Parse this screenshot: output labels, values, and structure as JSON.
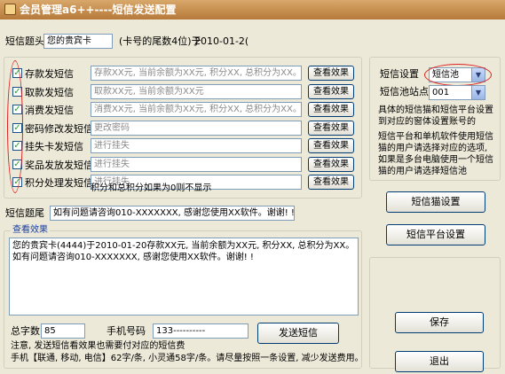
{
  "window": {
    "title": "会员管理a6++----短信发送配置"
  },
  "header": {
    "title_label": "短信题头",
    "title_value": "您的贵宾卡",
    "suffix_note": "(卡号的尾数4位)于",
    "date_value": "2010-01-2("
  },
  "message_types": [
    {
      "label": "存款发短信",
      "checked": true,
      "template": "存款XX元, 当前余额为XX元, 积分XX, 总积分为XX。",
      "button": "查看效果"
    },
    {
      "label": "取款发短信",
      "checked": true,
      "template": "取款XX元, 当前余额为XX元",
      "button": "查看效果"
    },
    {
      "label": "消费发短信",
      "checked": true,
      "template": "消费XX元, 当前余额为XX元, 积分XX, 总积分为XX。",
      "button": "查看效果"
    },
    {
      "label": "密码修改发短信",
      "checked": true,
      "template": "更改密码",
      "button": "查看效果"
    },
    {
      "label": "挂失卡发短信",
      "checked": true,
      "template": "进行挂失",
      "button": "查看效果"
    },
    {
      "label": "奖品发放发短信",
      "checked": true,
      "template": "进行挂失",
      "button": "查看效果"
    },
    {
      "label": "积分处理发短信",
      "checked": true,
      "template": "进行挂失",
      "button": "查看效果"
    }
  ],
  "zero_points_note": "积分和总积分如果为0则不显示",
  "footer_sms": {
    "label": "短信题尾",
    "value": "如有问题请咨询010-XXXXXXX, 感谢您使用XX软件。谢谢! !"
  },
  "preview": {
    "legend": "查看效果",
    "text": "您的贵宾卡(4444)于2010-01-20存款XX元, 当前余额为XX元, 积分XX, 总积分为XX。如有问题请咨询010-XXXXXXX, 感谢您使用XX软件。谢谢! !",
    "word_count_label": "总字数",
    "word_count_value": "85",
    "phone_label": "手机号码",
    "phone_value": "133----------",
    "send_button": "发送短信",
    "note1": "注意, 发送短信看效果也需要付对应的短信费",
    "note2": "手机【联通, 移动, 电信】62字/条, 小灵通58字/条。请尽量按照一条设置, 减少发送费用。"
  },
  "settings": {
    "sms_setting_label": "短信设置",
    "sms_setting_value": "短信池",
    "pool_site_label": "短信池站点号",
    "pool_site_value": "001",
    "desc1": "具体的短信猫和短信平台设置到对应的窗体设置账号的",
    "desc2": "短信平台和单机软件使用短信猫的用户请选择对应的选项, 如果是多台电脑使用一个短信猫的用户请选择短信池",
    "modem_button": "短信猫设置",
    "platform_button": "短信平台设置",
    "save_button": "保存",
    "exit_button": "退出"
  },
  "colors": {
    "title_bar": "#b6793a",
    "accent_checkmark": "#21a121",
    "annotation_red": "#d22222"
  }
}
